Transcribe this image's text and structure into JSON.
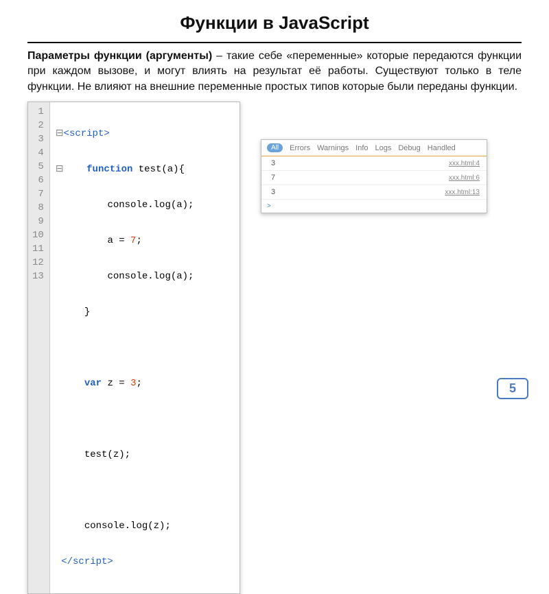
{
  "title": "Функции в JavaScript",
  "paragraph": {
    "strong": "Параметры функции (аргументы)",
    "rest": " – такие себе «переменные» которые передаются функции при каждом вызове, и могут влиять на результат её работы. Существуют только в теле функции. Не влияют на внешние переменные простых типов которые были переданы функции."
  },
  "code": {
    "lines": [
      "1",
      "2",
      "3",
      "4",
      "5",
      "6",
      "7",
      "8",
      "9",
      "10",
      "11",
      "12",
      "13"
    ],
    "l1_open": "<script>",
    "l2_kw": "function",
    "l2_rest": " test(a){",
    "l3": "console.log(a);",
    "l4_a": "a = ",
    "l4_num": "7",
    "l4_b": ";",
    "l5": "console.log(a);",
    "l6": "}",
    "l8_kw": "var",
    "l8_a": " z = ",
    "l8_num": "3",
    "l8_b": ";",
    "l10": "test(z);",
    "l12": "console.log(z);",
    "l13_close": "</script>"
  },
  "console": {
    "tabs": {
      "all": "All",
      "errors": "Errors",
      "warnings": "Warnings",
      "info": "Info",
      "logs": "Logs",
      "debug": "Debug",
      "handled": "Handled"
    },
    "rows": [
      {
        "val": "3",
        "loc": "xxx.html:4"
      },
      {
        "val": "7",
        "loc": "xxx.html:6"
      },
      {
        "val": "3",
        "loc": "xxx.html:13"
      }
    ],
    "prompt": ">"
  },
  "page_number": "5"
}
